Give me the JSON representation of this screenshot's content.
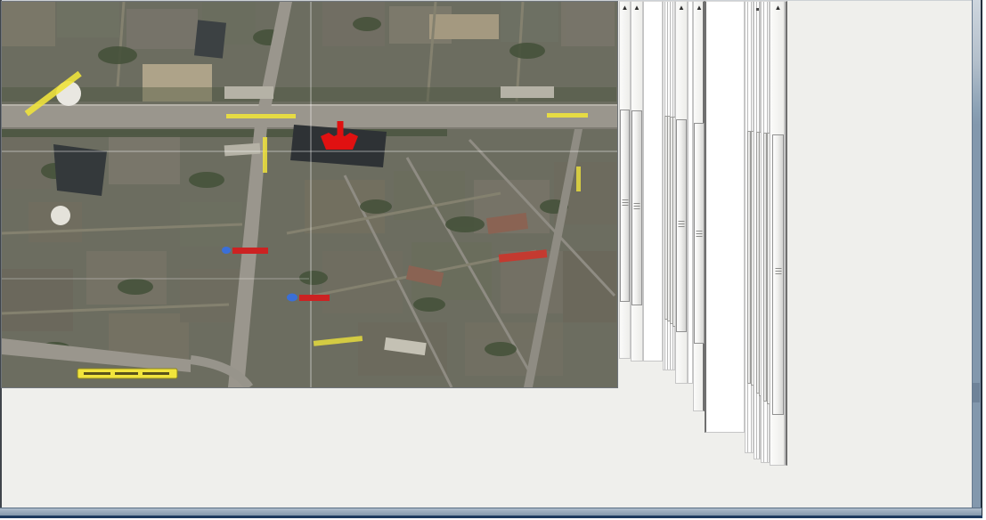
{
  "window": {
    "client_background": "#efefec",
    "frame_accent_color": "#8398ad",
    "frame_navy_color": "#1d3a5f",
    "frame_dark_edge_color": "#232e3c"
  },
  "map": {
    "type": "satellite-imagery",
    "marker": {
      "name": "red-arrow-marker",
      "color": "#e01111"
    },
    "street_label_color": "#eee23c",
    "street_banner_color": "#f1e43c",
    "gridline_color": "#ffffff",
    "metro_icon_color": "#3a6fd8",
    "poi_sign_color": "#cc2222",
    "main_road_color": "#9a968d"
  },
  "scroll_panels": {
    "up_arrow_glyph": "▲",
    "full_scrollbar_count": 5,
    "hairline_scrollbar_count": 9
  }
}
